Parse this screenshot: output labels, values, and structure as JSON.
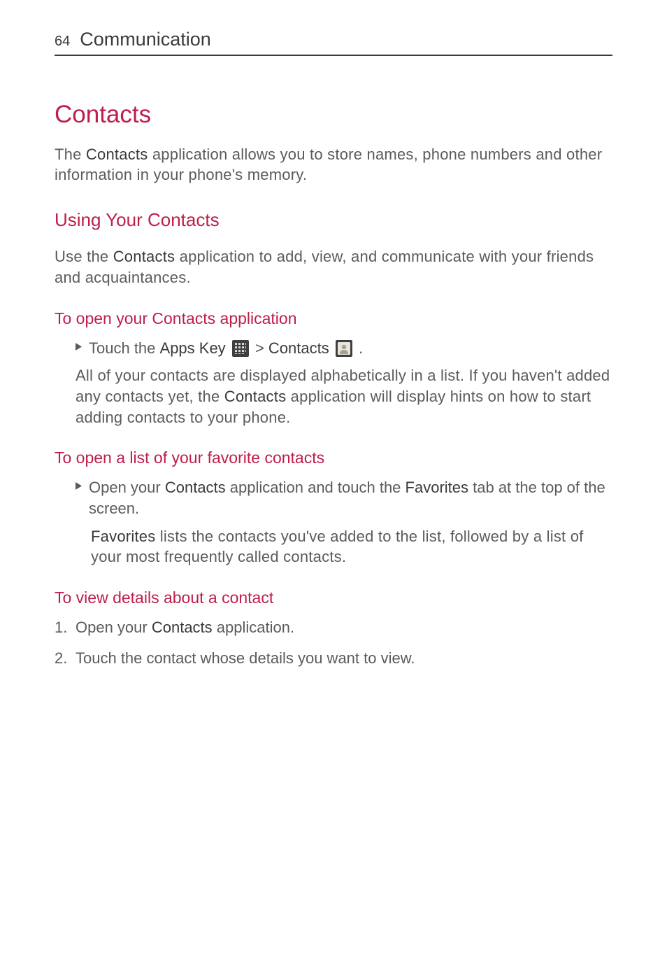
{
  "colors": {
    "accent": "#be1e4b",
    "body": "#5b5b5b",
    "heading_dark": "#3b3b3b"
  },
  "header": {
    "page_number": "64",
    "chapter": "Communication"
  },
  "title": "Contacts",
  "intro": {
    "pre": "The ",
    "bold": "Contacts",
    "post": " application allows you to store names, phone numbers and other information in your phone's memory."
  },
  "section1": {
    "heading": "Using Your Contacts",
    "body": {
      "pre": "Use the ",
      "bold": "Contacts",
      "post": " application to add, view, and communicate with your friends and acquaintances."
    }
  },
  "sub_open_app": {
    "heading": "To open your Contacts application",
    "bullet": {
      "pre": "Touch the ",
      "bold1": "Apps Key",
      "mid": " > ",
      "bold2": "Contacts",
      "end": " ."
    },
    "body": {
      "pre": "All of your contacts are displayed alphabetically in a list. If you haven't added any contacts yet, the ",
      "bold": "Contacts",
      "post": " application will display hints on how to start adding contacts to your phone."
    }
  },
  "sub_favorites": {
    "heading": "To open a list of your favorite contacts",
    "bullet": {
      "pre": "Open your ",
      "bold1": "Contacts",
      "mid": " application and touch the ",
      "bold2": "Favorites",
      "post": " tab at the top of the screen."
    },
    "body": {
      "bold": "Favorites",
      "post": " lists the contacts you've added to the list, followed by a list of your most frequently called contacts."
    }
  },
  "sub_details": {
    "heading": "To view details about a contact",
    "steps": [
      {
        "pre": "Open your ",
        "bold": "Contacts",
        "post": " application."
      },
      {
        "text": "Touch the contact whose details you want to view."
      }
    ]
  },
  "icons": {
    "apps_key": "apps-grid-icon",
    "contacts": "contacts-icon"
  }
}
